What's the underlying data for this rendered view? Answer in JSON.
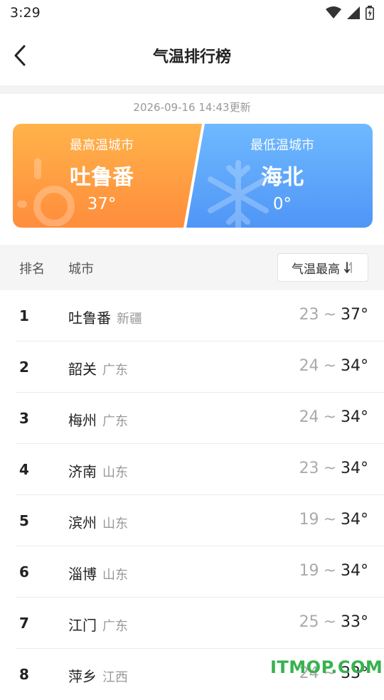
{
  "status": {
    "time": "3:29"
  },
  "header": {
    "title": "气温排行榜"
  },
  "update_time": "2026-09-16 14:43更新",
  "hottest": {
    "label": "最高温城市",
    "city": "吐鲁番",
    "temp": "37°"
  },
  "coldest": {
    "label": "最低温城市",
    "city": "海北",
    "temp": "0°"
  },
  "table": {
    "col_rank": "排名",
    "col_city": "城市",
    "sort_label": "气温最高",
    "rows": [
      {
        "rank": "1",
        "city": "吐鲁番",
        "province": "新疆",
        "low": "23",
        "high": "37°"
      },
      {
        "rank": "2",
        "city": "韶关",
        "province": "广东",
        "low": "24",
        "high": "34°"
      },
      {
        "rank": "3",
        "city": "梅州",
        "province": "广东",
        "low": "24",
        "high": "34°"
      },
      {
        "rank": "4",
        "city": "济南",
        "province": "山东",
        "low": "23",
        "high": "34°"
      },
      {
        "rank": "5",
        "city": "滨州",
        "province": "山东",
        "low": "19",
        "high": "34°"
      },
      {
        "rank": "6",
        "city": "淄博",
        "province": "山东",
        "low": "19",
        "high": "34°"
      },
      {
        "rank": "7",
        "city": "江门",
        "province": "广东",
        "low": "25",
        "high": "33°"
      },
      {
        "rank": "8",
        "city": "萍乡",
        "province": "江西",
        "low": "24",
        "high": "33°"
      }
    ]
  },
  "watermark": "ITMOP.COM"
}
